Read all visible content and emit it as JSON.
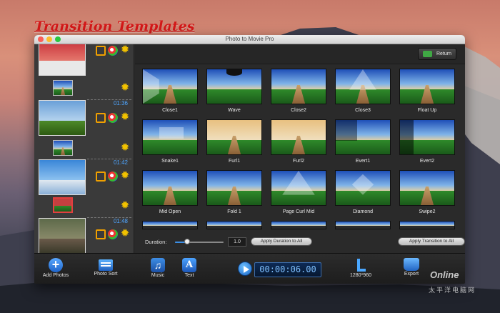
{
  "headline": "Transition Templates",
  "window": {
    "title": "Photo to Movie Pro"
  },
  "topbar": {
    "return_label": "Return"
  },
  "sidebar": {
    "durations": [
      "01:36",
      "01:42",
      "01:48"
    ]
  },
  "transitions": [
    {
      "name": "Close1"
    },
    {
      "name": "Wave"
    },
    {
      "name": "Close2"
    },
    {
      "name": "Close3"
    },
    {
      "name": "Float Up"
    },
    {
      "name": "Snake1"
    },
    {
      "name": "Furl1"
    },
    {
      "name": "Furl2"
    },
    {
      "name": "Evert1"
    },
    {
      "name": "Evert2"
    },
    {
      "name": "Mid Open"
    },
    {
      "name": "Fold 1"
    },
    {
      "name": "Page Curl Mid"
    },
    {
      "name": "Diamond"
    },
    {
      "name": "Swipe2"
    }
  ],
  "duration": {
    "label": "Duration:",
    "value": "1.0",
    "slider_fraction": 0.25,
    "apply_duration_label": "Apply Duration to All",
    "apply_transition_label": "Apply Transition to All"
  },
  "toolbar": {
    "add_photos": "Add Photos",
    "photo_sort": "Photo Sort",
    "music": "Music",
    "text": "Text",
    "timecode": "00:00:06.00",
    "resolution": "1280*960",
    "export": "Export"
  },
  "watermark": {
    "logo": "Online",
    "cn": "太平洋电脑网"
  },
  "colors": {
    "headline": "#d31818",
    "accent_blue": "#4ea5ff",
    "gear": "#f2c200"
  }
}
